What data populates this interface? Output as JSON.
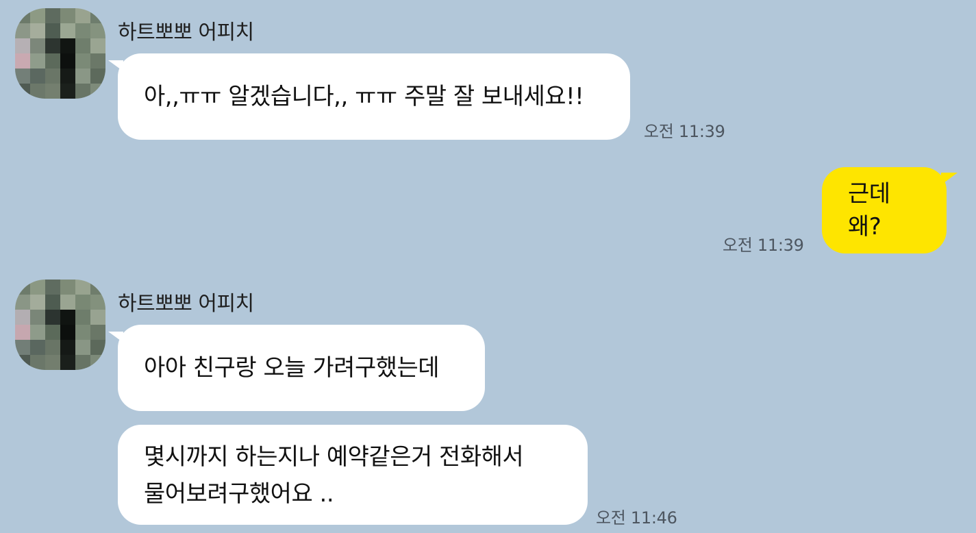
{
  "messages": [
    {
      "sender": "하트뽀뽀 어피치",
      "text": "아,,ㅠㅠ 알겠습니다,, ㅠㅠ 주말 잘 보내세요!!",
      "time": "오전 11:39"
    },
    {
      "text": "근데 왜?",
      "time": "오전 11:39"
    },
    {
      "sender": "하트뽀뽀 어피치",
      "text": "아아 친구랑 오늘 가려구했는데"
    },
    {
      "text_line1": "몇시까지 하는지나 예약같은거 전화해서",
      "text_line2": "물어보려구했어요 ..",
      "time": "오전 11:46"
    }
  ],
  "colors": {
    "background": "#b2c7d9",
    "incoming_bubble": "#ffffff",
    "outgoing_bubble": "#fee500"
  }
}
